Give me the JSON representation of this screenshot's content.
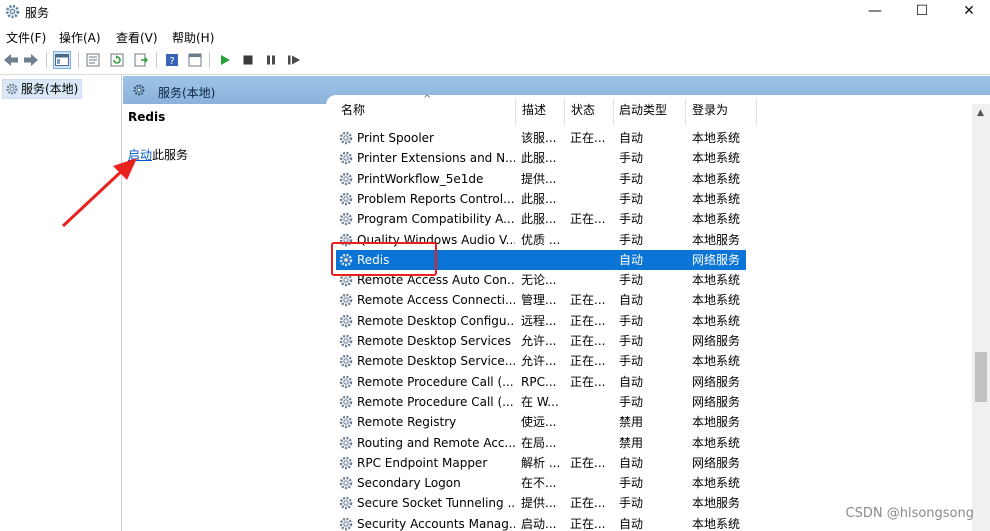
{
  "window": {
    "title": "服务",
    "minimize_glyph": "—",
    "maximize_glyph": "☐",
    "close_glyph": "✕"
  },
  "menu": [
    "文件(F)",
    "操作(A)",
    "查看(V)",
    "帮助(H)"
  ],
  "tree": {
    "root_label": "服务(本地)"
  },
  "header": {
    "label": "服务(本地)"
  },
  "details": {
    "service_name": "Redis",
    "action_link": "启动",
    "action_suffix": "此服务"
  },
  "columns": [
    "名称",
    "描述",
    "状态",
    "启动类型",
    "登录为"
  ],
  "services": [
    [
      "Print Spooler",
      "该服...",
      "正在...",
      "自动",
      "本地系统"
    ],
    [
      "Printer Extensions and N...",
      "此服...",
      "",
      "手动",
      "本地系统"
    ],
    [
      "PrintWorkflow_5e1de",
      "提供...",
      "",
      "手动",
      "本地系统"
    ],
    [
      "Problem Reports Control...",
      "此服...",
      "",
      "手动",
      "本地系统"
    ],
    [
      "Program Compatibility A...",
      "此服...",
      "正在...",
      "手动",
      "本地系统"
    ],
    [
      "Quality Windows Audio V...",
      "优质 ...",
      "",
      "手动",
      "本地服务"
    ],
    [
      "Redis",
      "",
      "",
      "自动",
      "网络服务"
    ],
    [
      "Remote Access Auto Con...",
      "无论...",
      "",
      "手动",
      "本地系统"
    ],
    [
      "Remote Access Connecti...",
      "管理...",
      "正在...",
      "自动",
      "本地系统"
    ],
    [
      "Remote Desktop Configu...",
      "远程...",
      "正在...",
      "手动",
      "本地系统"
    ],
    [
      "Remote Desktop Services",
      "允许...",
      "正在...",
      "手动",
      "网络服务"
    ],
    [
      "Remote Desktop Service...",
      "允许...",
      "正在...",
      "手动",
      "本地系统"
    ],
    [
      "Remote Procedure Call (...",
      "RPC...",
      "正在...",
      "自动",
      "网络服务"
    ],
    [
      "Remote Procedure Call (...",
      "在 W...",
      "",
      "手动",
      "网络服务"
    ],
    [
      "Remote Registry",
      "使远...",
      "",
      "禁用",
      "本地服务"
    ],
    [
      "Routing and Remote Acc...",
      "在局...",
      "",
      "禁用",
      "本地系统"
    ],
    [
      "RPC Endpoint Mapper",
      "解析 ...",
      "正在...",
      "自动",
      "网络服务"
    ],
    [
      "Secondary Logon",
      "在不...",
      "",
      "手动",
      "本地系统"
    ],
    [
      "Secure Socket Tunneling ...",
      "提供...",
      "正在...",
      "手动",
      "本地服务"
    ],
    [
      "Security Accounts Manag...",
      "启动...",
      "正在...",
      "自动",
      "本地系统"
    ]
  ],
  "selected_service": "Redis",
  "watermark": "CSDN @hlsongsong",
  "colors": {
    "selection": "#0a74d7",
    "header_band": "#9fc3e6",
    "annotation_red": "#e8211f",
    "link": "#0059c8"
  }
}
